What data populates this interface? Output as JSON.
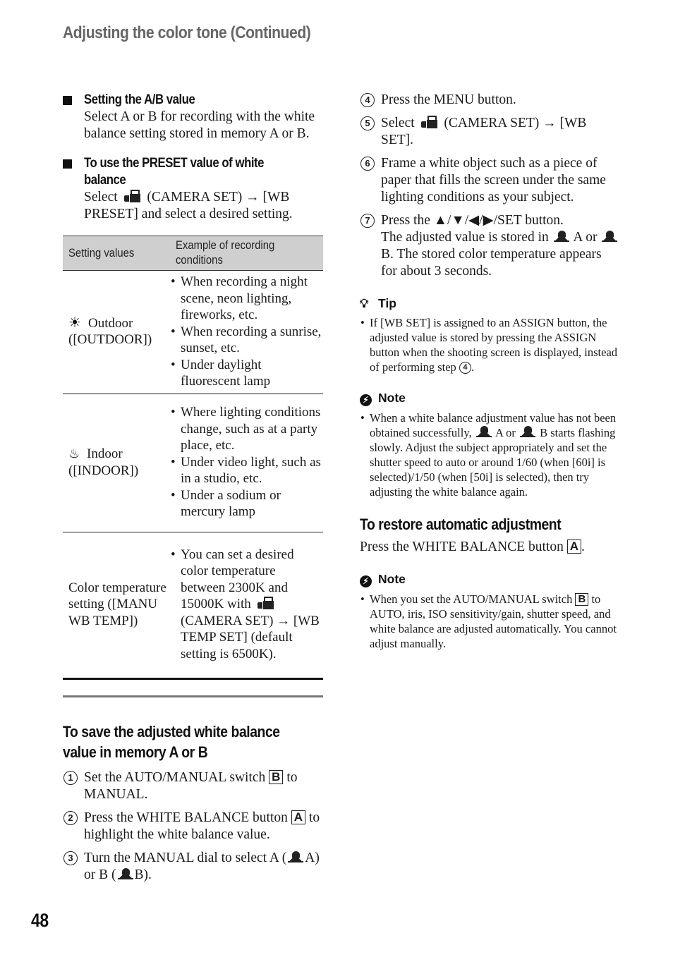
{
  "header": {
    "title": "Adjusting the color tone (Continued)"
  },
  "page_number": "48",
  "left": {
    "ab_value": {
      "heading": "Setting the A/B value",
      "body": "Select A or B for recording with the white balance setting stored in memory A or B."
    },
    "preset": {
      "heading_line1": "To use the PRESET value of white",
      "heading_line2": "balance",
      "body_pre": "Select",
      "icon": "camera-set-icon",
      "body_post": "(CAMERA SET) → [WB PRESET] and select a desired setting."
    },
    "table": {
      "headers": [
        "Setting values",
        "Example of recording conditions"
      ],
      "rows": [
        {
          "icon": "sun-icon",
          "icon_glyph": "☀",
          "setting_line1": "Outdoor",
          "setting_line2": "([OUTDOOR])",
          "examples": [
            "When recording a night scene, neon lighting, fireworks, etc.",
            "When recording a sunrise, sunset, etc.",
            "Under daylight fluorescent lamp"
          ]
        },
        {
          "icon": "light-bulb-icon",
          "icon_glyph": "♨",
          "setting_line1": "Indoor",
          "setting_line2": "([INDOOR])",
          "examples": [
            "Where lighting conditions change, such as at a party place, etc.",
            "Under video light, such as in a studio, etc.",
            "Under a sodium or mercury lamp"
          ]
        },
        {
          "icon": "",
          "setting": "Color temperature setting ([MANU WB TEMP])",
          "example_pre": "You can set a desired color temperature between 2300K and 15000K with",
          "example_icon": "camera-set-icon",
          "example_post": "(CAMERA SET) → [WB TEMP SET] (default setting is 6500K)."
        }
      ]
    },
    "save_section": {
      "heading": "To save the adjusted white balance value in memory A or B",
      "steps": [
        {
          "num": "1",
          "pre": "Set the AUTO/MANUAL switch",
          "box": "B",
          "post": "to MANUAL."
        },
        {
          "num": "2",
          "pre": "Press the WHITE BALANCE button",
          "box": "A",
          "post": "to highlight the white balance value."
        },
        {
          "num": "3",
          "pre": "Turn the MANUAL dial to select A (",
          "mid": "A) or B (",
          "post": "B)."
        }
      ]
    }
  },
  "right": {
    "steps": [
      {
        "num": "4",
        "text": "Press the MENU button."
      },
      {
        "num": "5",
        "pre": "Select",
        "post": "(CAMERA SET) → [WB SET]."
      },
      {
        "num": "6",
        "text": "Frame a white object such as a piece of paper that fills the screen under the same lighting conditions as your subject."
      },
      {
        "num": "7",
        "line1": "Press the ▲/▼/◀/▶/SET button.",
        "pre": "The adjusted value is stored in",
        "mid": "A or",
        "post": "B. The stored color temperature appears for about 3 seconds."
      }
    ],
    "tip": {
      "label": "Tip",
      "text_pre": "If [WB SET] is assigned to an ASSIGN button, the adjusted value is stored by pressing the ASSIGN button when the shooting screen is displayed, instead of performing step",
      "step_ref": "4",
      "text_post": "."
    },
    "note1": {
      "label": "Note",
      "pre": "When a white balance adjustment value has not been obtained successfully,",
      "mid": "A or",
      "post": "B starts flashing slowly. Adjust the subject appropriately and set the shutter speed to auto or around 1/60 (when [60i] is selected)/1/50 (when [50i] is selected), then try adjusting the white balance again."
    },
    "restore": {
      "heading": "To restore automatic adjustment",
      "pre": "Press the WHITE BALANCE button",
      "box": "A",
      "post": "."
    },
    "note2": {
      "label": "Note",
      "pre": "When you set the AUTO/MANUAL switch",
      "box": "B",
      "post": "to AUTO, iris, ISO sensitivity/gain, shutter speed, and white balance are adjusted automatically. You cannot adjust manually."
    }
  }
}
